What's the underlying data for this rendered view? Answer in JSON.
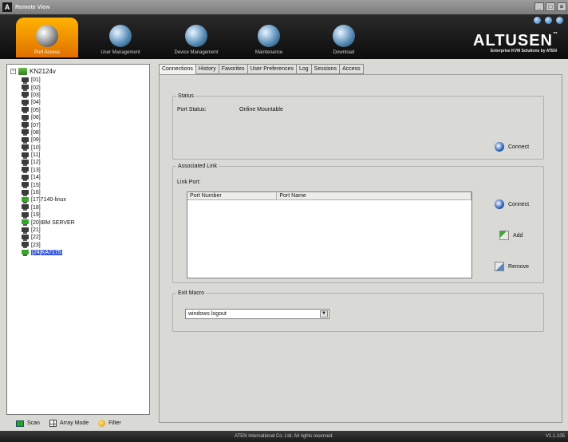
{
  "window": {
    "title": "Remote View",
    "logo": "A",
    "controls": [
      "_",
      "□",
      "×"
    ]
  },
  "nav": [
    {
      "label": "Port Access",
      "icon": "port-access-icon"
    },
    {
      "label": "User Management",
      "icon": "user-management-icon"
    },
    {
      "label": "Device Management",
      "icon": "device-management-icon"
    },
    {
      "label": "Maintenance",
      "icon": "maintenance-icon"
    },
    {
      "label": "Download",
      "icon": "download-icon"
    }
  ],
  "brand": {
    "name": "ALTUSEN",
    "tm": "™",
    "sub": "Enterprise KVM Solutions by ATEN"
  },
  "tree": {
    "root": "KN2124v",
    "items": [
      "[01]",
      "[02]",
      "[03]",
      "[04]",
      "[05]",
      "[06]",
      "[07]",
      "[08]",
      "[09]",
      "[10]",
      "[11]",
      "[12]",
      "[13]",
      "[14]",
      "[15]",
      "[16]",
      "[17]7140-linux",
      "[18]",
      "[19]",
      "[20]IBM SERVER",
      "[21]",
      "[22]",
      "[23]",
      "[24]KA7175"
    ],
    "online": [
      17,
      20,
      24
    ],
    "selected": 24
  },
  "left_tools": {
    "scan": "Scan",
    "array_mode": "Array Mode",
    "filter": "Filter"
  },
  "tabs": [
    "Connections",
    "History",
    "Favorites",
    "User Preferences",
    "Log",
    "Sessions",
    "Access"
  ],
  "status": {
    "legend": "Status",
    "port_status_label": "Port Status:",
    "port_status_value": "Online Mountable",
    "connect": "Connect"
  },
  "link": {
    "legend": "Associated Link",
    "link_port_label": "Link Port:",
    "col_port_number": "Port Number",
    "col_port_name": "Port Name",
    "connect": "Connect",
    "add": "Add",
    "remove": "Remove"
  },
  "macro": {
    "legend": "Exit Macro",
    "selected": "windows logout"
  },
  "statusbar": {
    "copyright": "ATEN International Co. Ltd. All rights reserved.",
    "version": "V1.1.105"
  }
}
